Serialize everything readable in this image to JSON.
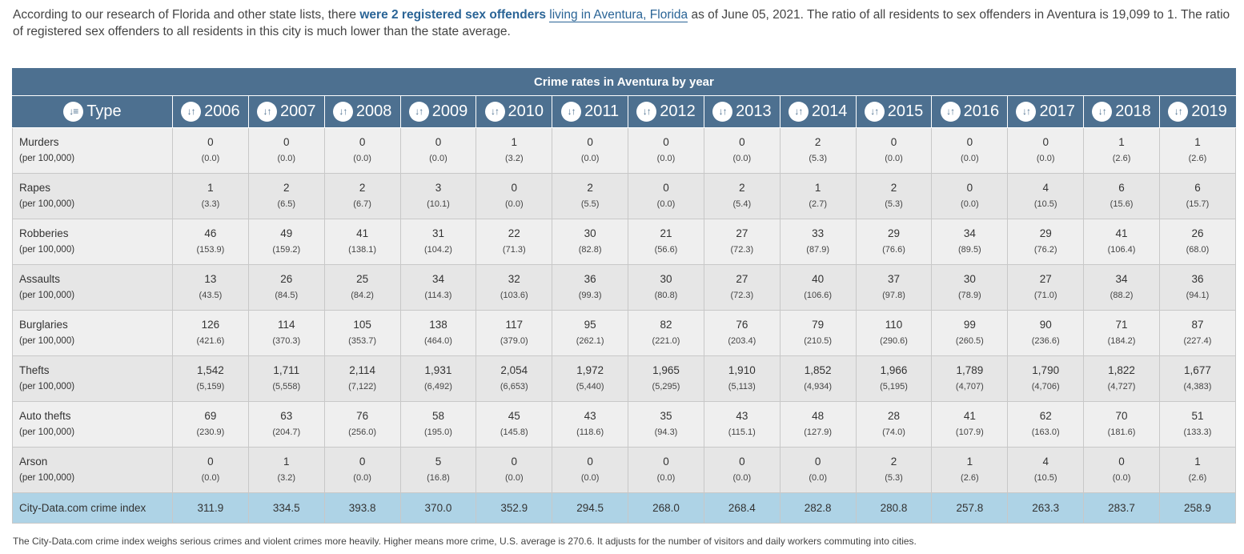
{
  "intro": {
    "p1": "According to our research of Florida and other state lists, there ",
    "link1": "were 2 registered sex offenders",
    "p2": " ",
    "link2": "living in Aventura, Florida",
    "p3": " as of June 05, 2021. The ratio of all residents to sex offenders in Aventura is 19,099 to 1. The ratio of registered sex offenders to all residents in this city is much lower than the state average."
  },
  "table": {
    "caption": "Crime rates in Aventura by year",
    "type_header": "Type",
    "sort_glyph": "↓↑",
    "type_sort_glyph": "↓≡",
    "years": [
      "2006",
      "2007",
      "2008",
      "2009",
      "2010",
      "2011",
      "2012",
      "2013",
      "2014",
      "2015",
      "2016",
      "2017",
      "2018",
      "2019"
    ],
    "rows": [
      {
        "name": "Murders",
        "sub": "(per 100,000)",
        "counts": [
          "0",
          "0",
          "0",
          "0",
          "1",
          "0",
          "0",
          "0",
          "2",
          "0",
          "0",
          "0",
          "1",
          "1"
        ],
        "rates": [
          "(0.0)",
          "(0.0)",
          "(0.0)",
          "(0.0)",
          "(3.2)",
          "(0.0)",
          "(0.0)",
          "(0.0)",
          "(5.3)",
          "(0.0)",
          "(0.0)",
          "(0.0)",
          "(2.6)",
          "(2.6)"
        ]
      },
      {
        "name": "Rapes",
        "sub": "(per 100,000)",
        "counts": [
          "1",
          "2",
          "2",
          "3",
          "0",
          "2",
          "0",
          "2",
          "1",
          "2",
          "0",
          "4",
          "6",
          "6"
        ],
        "rates": [
          "(3.3)",
          "(6.5)",
          "(6.7)",
          "(10.1)",
          "(0.0)",
          "(5.5)",
          "(0.0)",
          "(5.4)",
          "(2.7)",
          "(5.3)",
          "(0.0)",
          "(10.5)",
          "(15.6)",
          "(15.7)"
        ]
      },
      {
        "name": "Robberies",
        "sub": "(per 100,000)",
        "counts": [
          "46",
          "49",
          "41",
          "31",
          "22",
          "30",
          "21",
          "27",
          "33",
          "29",
          "34",
          "29",
          "41",
          "26"
        ],
        "rates": [
          "(153.9)",
          "(159.2)",
          "(138.1)",
          "(104.2)",
          "(71.3)",
          "(82.8)",
          "(56.6)",
          "(72.3)",
          "(87.9)",
          "(76.6)",
          "(89.5)",
          "(76.2)",
          "(106.4)",
          "(68.0)"
        ]
      },
      {
        "name": "Assaults",
        "sub": "(per 100,000)",
        "counts": [
          "13",
          "26",
          "25",
          "34",
          "32",
          "36",
          "30",
          "27",
          "40",
          "37",
          "30",
          "27",
          "34",
          "36"
        ],
        "rates": [
          "(43.5)",
          "(84.5)",
          "(84.2)",
          "(114.3)",
          "(103.6)",
          "(99.3)",
          "(80.8)",
          "(72.3)",
          "(106.6)",
          "(97.8)",
          "(78.9)",
          "(71.0)",
          "(88.2)",
          "(94.1)"
        ]
      },
      {
        "name": "Burglaries",
        "sub": "(per 100,000)",
        "counts": [
          "126",
          "114",
          "105",
          "138",
          "117",
          "95",
          "82",
          "76",
          "79",
          "110",
          "99",
          "90",
          "71",
          "87"
        ],
        "rates": [
          "(421.6)",
          "(370.3)",
          "(353.7)",
          "(464.0)",
          "(379.0)",
          "(262.1)",
          "(221.0)",
          "(203.4)",
          "(210.5)",
          "(290.6)",
          "(260.5)",
          "(236.6)",
          "(184.2)",
          "(227.4)"
        ]
      },
      {
        "name": "Thefts",
        "sub": "(per 100,000)",
        "counts": [
          "1,542",
          "1,711",
          "2,114",
          "1,931",
          "2,054",
          "1,972",
          "1,965",
          "1,910",
          "1,852",
          "1,966",
          "1,789",
          "1,790",
          "1,822",
          "1,677"
        ],
        "rates": [
          "(5,159)",
          "(5,558)",
          "(7,122)",
          "(6,492)",
          "(6,653)",
          "(5,440)",
          "(5,295)",
          "(5,113)",
          "(4,934)",
          "(5,195)",
          "(4,707)",
          "(4,706)",
          "(4,727)",
          "(4,383)"
        ]
      },
      {
        "name": "Auto thefts",
        "sub": "(per 100,000)",
        "counts": [
          "69",
          "63",
          "76",
          "58",
          "45",
          "43",
          "35",
          "43",
          "48",
          "28",
          "41",
          "62",
          "70",
          "51"
        ],
        "rates": [
          "(230.9)",
          "(204.7)",
          "(256.0)",
          "(195.0)",
          "(145.8)",
          "(118.6)",
          "(94.3)",
          "(115.1)",
          "(127.9)",
          "(74.0)",
          "(107.9)",
          "(163.0)",
          "(181.6)",
          "(133.3)"
        ]
      },
      {
        "name": "Arson",
        "sub": "(per 100,000)",
        "counts": [
          "0",
          "1",
          "0",
          "5",
          "0",
          "0",
          "0",
          "0",
          "0",
          "2",
          "1",
          "4",
          "0",
          "1"
        ],
        "rates": [
          "(0.0)",
          "(3.2)",
          "(0.0)",
          "(16.8)",
          "(0.0)",
          "(0.0)",
          "(0.0)",
          "(0.0)",
          "(0.0)",
          "(5.3)",
          "(2.6)",
          "(10.5)",
          "(0.0)",
          "(2.6)"
        ]
      }
    ],
    "index_row": {
      "label": "City-Data.com crime index",
      "values": [
        "311.9",
        "334.5",
        "393.8",
        "370.0",
        "352.9",
        "294.5",
        "268.0",
        "268.4",
        "282.8",
        "280.8",
        "257.8",
        "263.3",
        "283.7",
        "258.9"
      ]
    }
  },
  "footnote": "The City-Data.com crime index weighs serious crimes and violent crimes more heavily. Higher means more crime, U.S. average is 270.6. It adjusts for the number of visitors and daily workers commuting into cities.",
  "colors": {
    "header_bg": "#4d7090",
    "index_row_bg": "#aed3e6",
    "link": "#2a6496"
  }
}
